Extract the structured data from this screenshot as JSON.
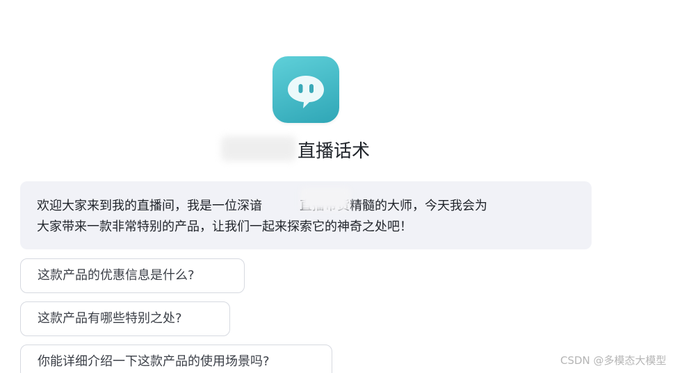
{
  "header": {
    "app_icon": "chat-bubble-icon",
    "title_suffix": "直播话术"
  },
  "welcome_message": {
    "line1": "欢迎大家来到我的直播间，我是一位深谙",
    "line1_end": "直播带货精髓的大师，今天我会为",
    "line2": "大家带来一款非常特别的产品，让我们一起来探索它的神奇之处吧！"
  },
  "suggestions": [
    {
      "label": "这款产品的优惠信息是什么?"
    },
    {
      "label": "这款产品有哪些特别之处?"
    },
    {
      "label": "你能详细介绍一下这款产品的使用场景吗?"
    }
  ],
  "watermark": {
    "text": "CSDN @多模态大模型"
  },
  "colors": {
    "icon_gradient_start": "#5fd0d9",
    "icon_gradient_end": "#2fa6b6",
    "message_background": "#f1f2f7",
    "suggestion_border": "#d6d9e0"
  }
}
